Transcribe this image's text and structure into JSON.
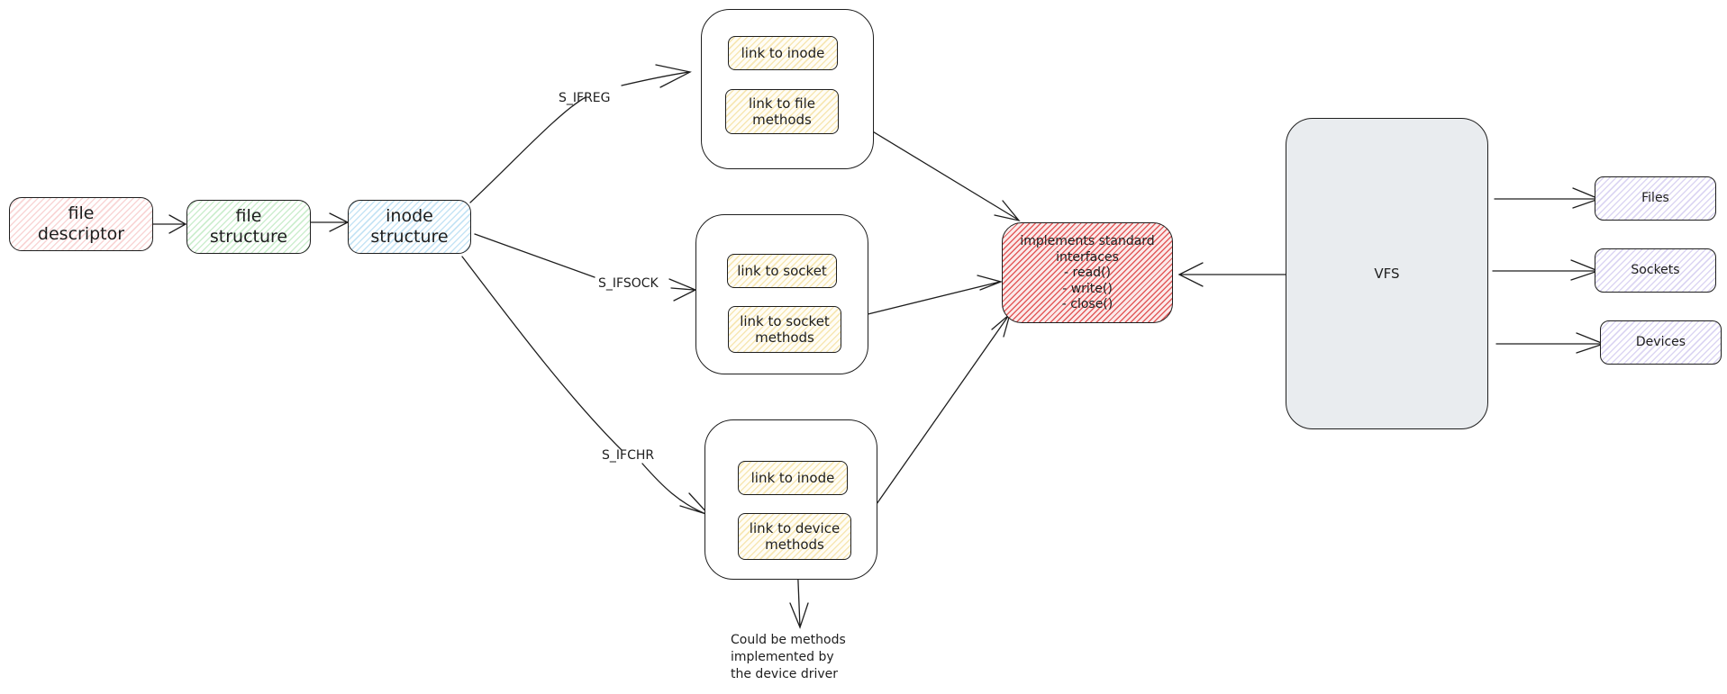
{
  "diagram": {
    "chain": {
      "file_descriptor": "file\ndescriptor",
      "file_structure": "file\nstructure",
      "inode_structure": "inode\nstructure"
    },
    "edge_labels": {
      "s_ifreg": "S_IFREG",
      "s_ifsock": "S_IFSOCK",
      "s_ifchr": "S_IFCHR"
    },
    "regular_file_group": {
      "link_to_inode": "link to inode",
      "link_to_methods": "link to file\nmethods"
    },
    "socket_group": {
      "link_to_socket": "link to socket",
      "link_to_methods": "link to socket\nmethods"
    },
    "device_group": {
      "link_to_inode": "link to inode",
      "link_to_methods": "link to device\nmethods"
    },
    "interfaces_box": "implements standard\ninterfaces\n- read()\n- write()\n- close()",
    "vfs": "VFS",
    "vfs_targets": {
      "files": "Files",
      "sockets": "Sockets",
      "devices": "Devices"
    },
    "note": "Could be methods\nimplemented by\nthe device driver",
    "colors": {
      "stroke": "#1e1e1e",
      "fd_fill": "#f9d6d6",
      "file_struct_fill": "#cdeecf",
      "inode_fill": "#c6e4f5",
      "link_fill": "#f7e7b4",
      "target_fill": "#dcd6f3",
      "interfaces_fill": "#e35b5b",
      "vfs_fill": "#e9ecef"
    }
  }
}
